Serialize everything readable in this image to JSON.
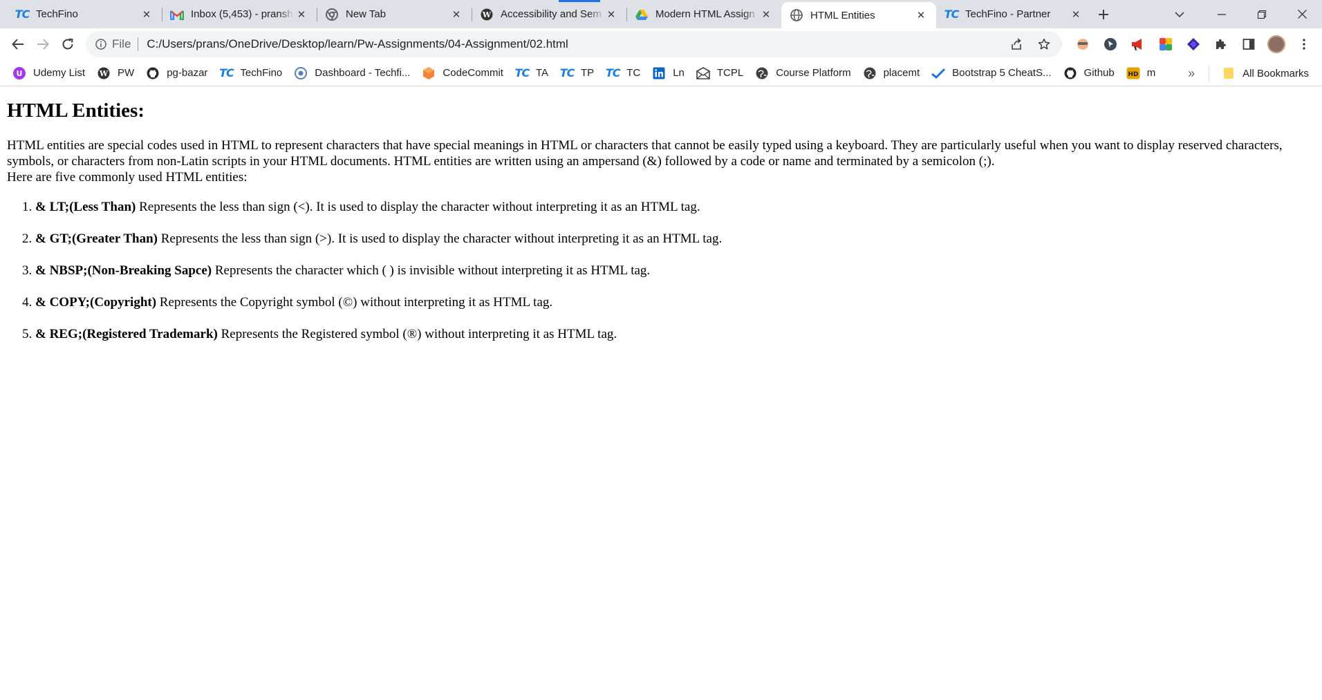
{
  "browser": {
    "tabs": [
      {
        "title": "TechFino",
        "icon": "techfino-icon",
        "active": false
      },
      {
        "title": "Inbox (5,453) - pransh",
        "icon": "gmail-icon",
        "active": false
      },
      {
        "title": "New Tab",
        "icon": "chrome-icon",
        "active": false
      },
      {
        "title": "Accessibility and Sem",
        "icon": "wordpress-icon",
        "active": false
      },
      {
        "title": "Modern HTML Assign",
        "icon": "google-drive-icon",
        "active": false
      },
      {
        "title": "HTML Entities",
        "icon": "globe-icon",
        "active": true
      },
      {
        "title": "TechFino - Partner",
        "icon": "techfino-icon",
        "active": false
      }
    ],
    "address": {
      "scheme": "File",
      "url": "C:/Users/prans/OneDrive/Desktop/learn/Pw-Assignments/04-Assignment/02.html"
    },
    "bookmarks": [
      {
        "label": "Udemy List",
        "icon": "udemy-icon"
      },
      {
        "label": "PW",
        "icon": "wordpress-icon"
      },
      {
        "label": "pg-bazar",
        "icon": "github-icon"
      },
      {
        "label": "TechFino",
        "icon": "techfino-icon"
      },
      {
        "label": "Dashboard - Techfi...",
        "icon": "dashboard-icon"
      },
      {
        "label": "CodeCommit",
        "icon": "codecommit-icon"
      },
      {
        "label": "TA",
        "icon": "techfino-icon"
      },
      {
        "label": "TP",
        "icon": "techfino-icon"
      },
      {
        "label": "TC",
        "icon": "techfino-icon"
      },
      {
        "label": "Ln",
        "icon": "linkedin-icon"
      },
      {
        "label": "TCPL",
        "icon": "mail-icon"
      },
      {
        "label": "Course Platform",
        "icon": "globe-icon"
      },
      {
        "label": "placemt",
        "icon": "globe-icon"
      },
      {
        "label": "Bootstrap 5 CheatS...",
        "icon": "check-icon"
      },
      {
        "label": "Github",
        "icon": "github-icon"
      },
      {
        "label": "m",
        "icon": "hd-icon"
      }
    ],
    "all_bookmarks": "All Bookmarks",
    "overflow": "»"
  },
  "content": {
    "heading": "HTML Entities:",
    "intro": "HTML entities are special codes used in HTML to represent characters that have special meanings in HTML or characters that cannot be easily typed using a keyboard. They are particularly useful when you want to display reserved characters, symbols, or characters from non-Latin scripts in your HTML documents. HTML entities are written using an ampersand (&) followed by a code or name and terminated by a semicolon (;).",
    "lead": "Here are five commonly used HTML entities:",
    "entities": [
      {
        "name": "& LT;(Less Than)",
        "desc": " Represents the less than sign (<). It is used to display the character without interpreting it as an HTML tag."
      },
      {
        "name": "& GT;(Greater Than)",
        "desc": " Represents the less than sign (>). It is used to display the character without interpreting it as an HTML tag."
      },
      {
        "name": "& NBSP;(Non-Breaking Sapce)",
        "desc": " Represents the character which ( ) is invisible without interpreting it as HTML tag."
      },
      {
        "name": "& COPY;(Copyright)",
        "desc": " Represents the Copyright symbol (©) without interpreting it as HTML tag."
      },
      {
        "name": "& REG;(Registered Trademark)",
        "desc": " Represents the Registered symbol (®) without interpreting it as HTML tag."
      }
    ]
  }
}
